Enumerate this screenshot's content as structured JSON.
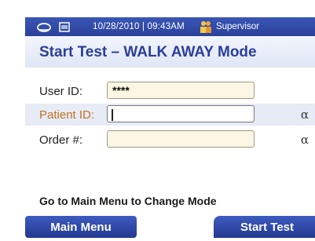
{
  "status_bar": {
    "datetime": "10/28/2010 | 09:43AM",
    "role": "Supervisor",
    "icons": [
      "cloud-icon",
      "sd-card-icon",
      "user-icon"
    ],
    "color": "#2f4aa8"
  },
  "title": "Start Test – WALK AWAY Mode",
  "form": {
    "user_id": {
      "label": "User ID:",
      "value": "****"
    },
    "patient_id": {
      "label": "Patient ID:",
      "value": "",
      "alpha": "α"
    },
    "order": {
      "label": "Order #:",
      "value": "",
      "alpha": "α"
    }
  },
  "hint": "Go to Main Menu to Change Mode",
  "buttons": {
    "main_menu": "Main Menu",
    "start_test": "Start Test"
  }
}
